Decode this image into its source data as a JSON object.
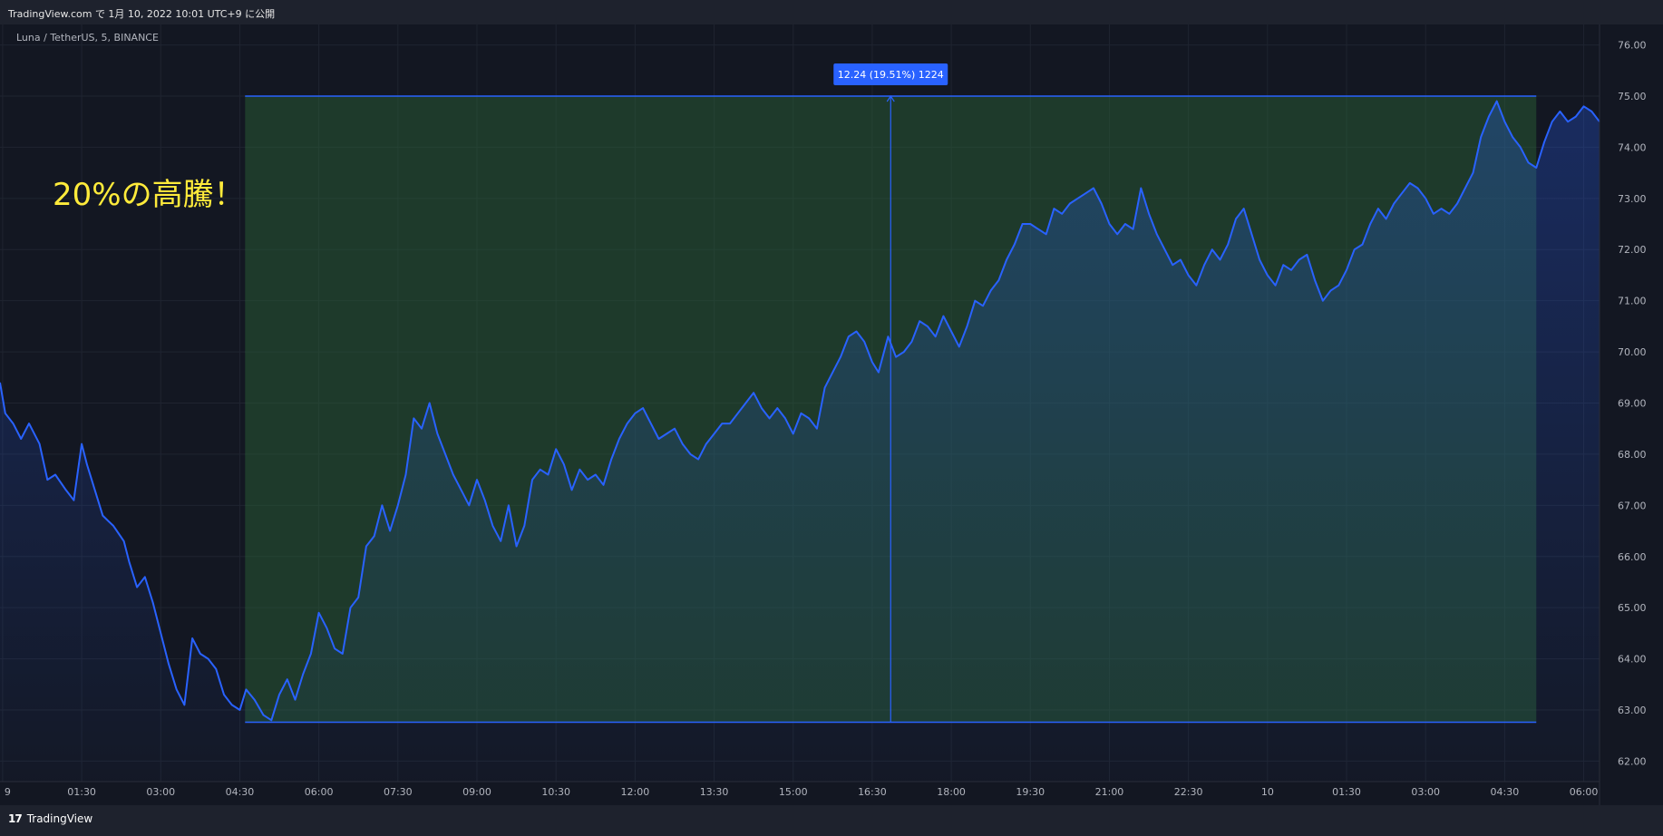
{
  "header": {
    "publish_text": "TradingView.com で 1月 10, 2022 10:01 UTC+9 に公開"
  },
  "symbol_legend": "Luna / TetherUS, 5, BINANCE",
  "annotation_text": "20%の高騰！",
  "measure_label": "12.24 (19.51%) 1224",
  "footer": {
    "brand_logo": "17",
    "brand_name": "TradingView"
  },
  "icons": [
    "tradingview-logo-icon"
  ],
  "colors": {
    "background": "#131722",
    "line": "#2962ff",
    "range_fill": "#1e4a2e",
    "annotation": "#ffeb3b",
    "measure_badge": "#2962ff"
  },
  "chart_data": {
    "type": "area",
    "title": "",
    "xlabel": "",
    "ylabel": "",
    "ylim": [
      61.6,
      76.4
    ],
    "y_ticks": [
      "76.00",
      "75.00",
      "74.00",
      "73.00",
      "72.00",
      "71.00",
      "70.00",
      "69.00",
      "68.00",
      "67.00",
      "66.00",
      "65.00",
      "64.00",
      "63.00",
      "62.00"
    ],
    "x_ticks": [
      "9",
      "01:30",
      "03:00",
      "04:30",
      "06:00",
      "07:30",
      "09:00",
      "10:30",
      "12:00",
      "13:30",
      "15:00",
      "16:30",
      "18:00",
      "19:30",
      "21:00",
      "22:30",
      "10",
      "01:30",
      "03:00",
      "04:30",
      "06:00"
    ],
    "x_tick_hours": [
      0,
      1.5,
      3,
      4.5,
      6,
      7.5,
      9,
      10.5,
      12,
      13.5,
      15,
      16.5,
      18,
      19.5,
      21,
      22.5,
      24,
      25.5,
      27,
      28.5,
      30
    ],
    "x_range_hours": [
      -0.05,
      30.3
    ],
    "series": [
      {
        "values_x_hours": [
          -0.05,
          0.05,
          0.2,
          0.35,
          0.5,
          0.7,
          0.85,
          1.0,
          1.2,
          1.35,
          1.5,
          1.6,
          1.75,
          1.9,
          2.0,
          2.1,
          2.3,
          2.4,
          2.55,
          2.7,
          2.85,
          3.0,
          3.15,
          3.3,
          3.45,
          3.6,
          3.75,
          3.9,
          4.05,
          4.2,
          4.35,
          4.5,
          4.62,
          4.78,
          4.95,
          5.1,
          5.25,
          5.4,
          5.55,
          5.7,
          5.85,
          6.0,
          6.15,
          6.3,
          6.45,
          6.6,
          6.75,
          6.9,
          7.05,
          7.2,
          7.35,
          7.5,
          7.65,
          7.8,
          7.95,
          8.1,
          8.25,
          8.4,
          8.55,
          8.7,
          8.85,
          9.0,
          9.15,
          9.3,
          9.45,
          9.6,
          9.75,
          9.9,
          10.05,
          10.2,
          10.35,
          10.5,
          10.65,
          10.8,
          10.95,
          11.1,
          11.25,
          11.4,
          11.55,
          11.7,
          11.85,
          12.0,
          12.15,
          12.3,
          12.45,
          12.6,
          12.75,
          12.9,
          13.05,
          13.2,
          13.35,
          13.5,
          13.65,
          13.8,
          13.95,
          14.1,
          14.25,
          14.4,
          14.55,
          14.7,
          14.85,
          15.0,
          15.15,
          15.3,
          15.45,
          15.6,
          15.75,
          15.9,
          16.05,
          16.2,
          16.35,
          16.5,
          16.62,
          16.8,
          16.95,
          17.1,
          17.25,
          17.4,
          17.55,
          17.7,
          17.85,
          18.0,
          18.15,
          18.3,
          18.45,
          18.6,
          18.75,
          18.9,
          19.05,
          19.2,
          19.35,
          19.5,
          19.65,
          19.8,
          19.95,
          20.1,
          20.25,
          20.4,
          20.55,
          20.7,
          20.85,
          21.0,
          21.15,
          21.3,
          21.45,
          21.6,
          21.75,
          21.9,
          22.05,
          22.2,
          22.35,
          22.5,
          22.65,
          22.8,
          22.95,
          23.1,
          23.25,
          23.4,
          23.55,
          23.7,
          23.85,
          24.0,
          24.15,
          24.3,
          24.45,
          24.6,
          24.75,
          24.9,
          25.05,
          25.2,
          25.35,
          25.5,
          25.65,
          25.8,
          25.95,
          26.1,
          26.25,
          26.4,
          26.55,
          26.7,
          26.85,
          27.0,
          27.15,
          27.3,
          27.45,
          27.6,
          27.75,
          27.9,
          28.05,
          28.2,
          28.35,
          28.5,
          28.65,
          28.8,
          28.95,
          29.1,
          29.25,
          29.4,
          29.55,
          29.7,
          29.85,
          30.0,
          30.15,
          30.3
        ],
        "values_y": [
          69.4,
          68.8,
          68.6,
          68.3,
          68.6,
          68.2,
          67.5,
          67.6,
          67.3,
          67.1,
          68.2,
          67.8,
          67.3,
          66.8,
          66.7,
          66.6,
          66.3,
          65.9,
          65.4,
          65.6,
          65.1,
          64.5,
          63.9,
          63.4,
          63.1,
          64.4,
          64.1,
          64.0,
          63.8,
          63.3,
          63.1,
          63.0,
          63.4,
          63.2,
          62.9,
          62.8,
          63.3,
          63.6,
          63.2,
          63.7,
          64.1,
          64.9,
          64.6,
          64.2,
          64.1,
          65.0,
          65.2,
          66.2,
          66.4,
          67.0,
          66.5,
          67.0,
          67.6,
          68.7,
          68.5,
          69.0,
          68.4,
          68.0,
          67.6,
          67.3,
          67.0,
          67.5,
          67.1,
          66.6,
          66.3,
          67.0,
          66.2,
          66.6,
          67.5,
          67.7,
          67.6,
          68.1,
          67.8,
          67.3,
          67.7,
          67.5,
          67.6,
          67.4,
          67.9,
          68.3,
          68.6,
          68.8,
          68.9,
          68.6,
          68.3,
          68.4,
          68.5,
          68.2,
          68.0,
          67.9,
          68.2,
          68.4,
          68.6,
          68.6,
          68.8,
          69.0,
          69.2,
          68.9,
          68.7,
          68.9,
          68.7,
          68.4,
          68.8,
          68.7,
          68.5,
          69.3,
          69.6,
          69.9,
          70.3,
          70.4,
          70.2,
          69.8,
          69.6,
          70.3,
          69.9,
          70.0,
          70.2,
          70.6,
          70.5,
          70.3,
          70.7,
          70.4,
          70.1,
          70.5,
          71.0,
          70.9,
          71.2,
          71.4,
          71.8,
          72.1,
          72.5,
          72.5,
          72.4,
          72.3,
          72.8,
          72.7,
          72.9,
          73.0,
          73.1,
          73.2,
          72.9,
          72.5,
          72.3,
          72.5,
          72.4,
          73.2,
          72.7,
          72.3,
          72.0,
          71.7,
          71.8,
          71.5,
          71.3,
          71.7,
          72.0,
          71.8,
          72.1,
          72.6,
          72.8,
          72.3,
          71.8,
          71.5,
          71.3,
          71.7,
          71.6,
          71.8,
          71.9,
          71.4,
          71.0,
          71.2,
          71.3,
          71.6,
          72.0,
          72.1,
          72.5,
          72.8,
          72.6,
          72.9,
          73.1,
          73.3,
          73.2,
          73.0,
          72.7,
          72.8,
          72.7,
          72.9,
          73.2,
          73.5,
          74.2,
          74.6,
          74.9,
          74.5,
          74.2,
          74.0,
          73.7,
          73.6,
          74.1,
          74.5,
          74.7,
          74.5,
          74.6,
          74.8,
          74.7,
          74.5
        ]
      }
    ],
    "measure_range": {
      "start_hours": 4.6,
      "end_hours": 29.1,
      "low": 62.76,
      "high": 75.0,
      "change": "12.24",
      "change_pct": "19.51%",
      "bars": "1224"
    },
    "grid": true,
    "legend": "top-left"
  }
}
